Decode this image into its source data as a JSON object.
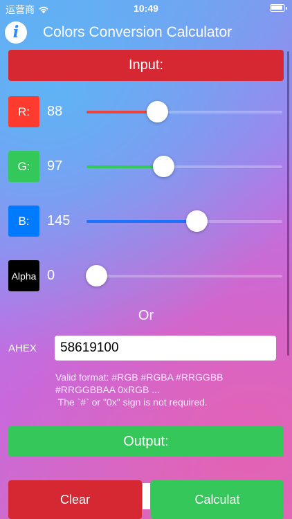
{
  "status_bar": {
    "carrier": "运营商",
    "time": "10:49"
  },
  "header": {
    "info_symbol": "i",
    "title": "Colors Conversion Calculator"
  },
  "input_header": "Input:",
  "channels": [
    {
      "label": "R:",
      "value": "88",
      "level": 0.345,
      "color": "#ff3b30",
      "track_color": "#e8453c"
    },
    {
      "label": "G:",
      "value": "97",
      "level": 0.38,
      "color": "#34c759",
      "track_color": "#34c759"
    },
    {
      "label": "B:",
      "value": "145",
      "level": 0.569,
      "color": "#007aff",
      "track_color": "#1a73ff"
    },
    {
      "label": "Alpha",
      "value": "0",
      "level": 0.0,
      "color": "#000000",
      "track_color": "#ffffff"
    }
  ],
  "or_label": "Or",
  "ahex": {
    "label": "AHEX",
    "value": "58619100",
    "hint_lines": [
      "Valid format: #RGB #RGBA #RRGGBB",
      "#RRGGBBAA 0xRGB ...",
      " The `#` or \"0x\" sign is not required."
    ]
  },
  "output_header": "Output:",
  "buttons": {
    "clear": "Clear",
    "calculate": "Calculat"
  },
  "colors": {
    "red_bar": "#d52832",
    "green_bar": "#35c759"
  }
}
